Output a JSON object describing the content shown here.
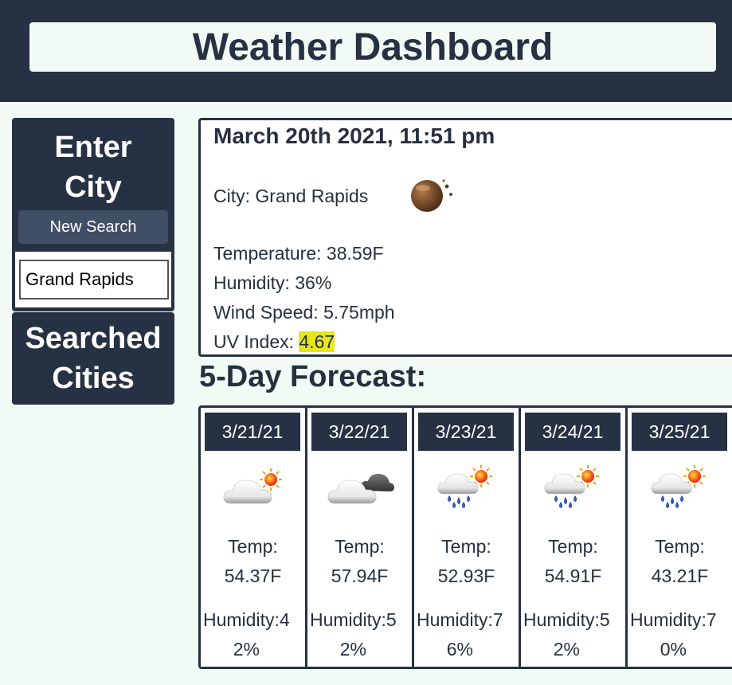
{
  "header": {
    "title": "Weather Dashboard"
  },
  "sidebar": {
    "enter_city_line1": "Enter",
    "enter_city_line2": "City",
    "new_search_label": "New Search",
    "city_input_value": "Grand Rapids",
    "searched_line1": "Searched",
    "searched_line2": "Cities"
  },
  "current": {
    "date": "March 20th 2021, 11:51 pm",
    "city": "City: Grand Rapids",
    "icon": "night-moon-icon",
    "temperature": "Temperature: 38.59F",
    "humidity": "Humidity: 36%",
    "wind": "Wind Speed: 5.75mph",
    "uv_label": "UV Index: ",
    "uv_value": "4.67",
    "uv_color": "#e6e619"
  },
  "forecast": {
    "title": "5-Day Forecast:",
    "days": [
      {
        "date": "3/21/21",
        "icon": "partly-sunny-icon",
        "temp_label": "Temp:",
        "temp": "54.37F",
        "hum_line1": "Humidity:4",
        "hum_line2": "2%"
      },
      {
        "date": "3/22/21",
        "icon": "cloudy-icon",
        "temp_label": "Temp:",
        "temp": "57.94F",
        "hum_line1": "Humidity:5",
        "hum_line2": "2%"
      },
      {
        "date": "3/23/21",
        "icon": "rain-sun-icon",
        "temp_label": "Temp:",
        "temp": "52.93F",
        "hum_line1": "Humidity:7",
        "hum_line2": "6%"
      },
      {
        "date": "3/24/21",
        "icon": "rain-sun-icon",
        "temp_label": "Temp:",
        "temp": "54.91F",
        "hum_line1": "Humidity:5",
        "hum_line2": "2%"
      },
      {
        "date": "3/25/21",
        "icon": "rain-sun-icon",
        "temp_label": "Temp:",
        "temp": "43.21F",
        "hum_line1": "Humidity:7",
        "hum_line2": "0%"
      }
    ]
  },
  "colors": {
    "dark": "#263243",
    "button": "#414f66",
    "background": "#f2faf5"
  }
}
